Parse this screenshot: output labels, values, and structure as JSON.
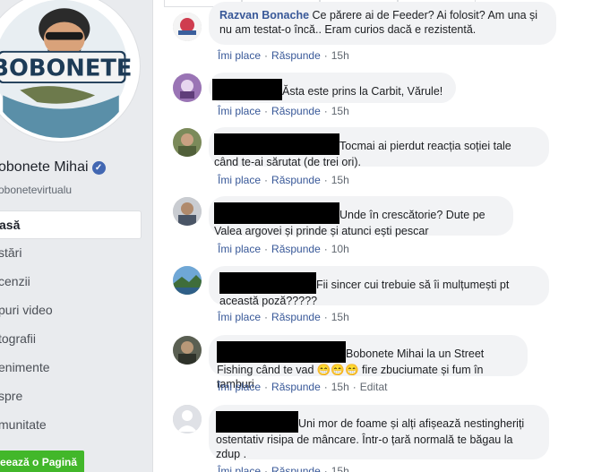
{
  "sidebar": {
    "logo_text": "BOBONETE",
    "page_name": "obonete Mihai",
    "handle": "obonetevirtualu",
    "nav_items": [
      {
        "label": "asă",
        "active": true
      },
      {
        "label": "stări",
        "active": false
      },
      {
        "label": "cenzii",
        "active": false
      },
      {
        "label": "puri video",
        "active": false
      },
      {
        "label": "tografii",
        "active": false
      },
      {
        "label": "enimente",
        "active": false
      },
      {
        "label": "spre",
        "active": false
      },
      {
        "label": "munitate",
        "active": false
      }
    ],
    "create_page_button": "eează o Pagină"
  },
  "actions": {
    "like": "Îmi place",
    "reply": "Răspunde",
    "edited": "Editat"
  },
  "comments": [
    {
      "author": "Razvan Bonache",
      "text": "Ce părere ai de Feeder? Ai folosit? Am una și nu am testat-o încă.. Eram curios dacă e rezistentă.",
      "time": "15h"
    },
    {
      "text": "Ăsta este prins la Carbit, Vărule!",
      "time": "15h"
    },
    {
      "text": "Tocmai ai pierdut reacția soției tale când te-ai sărutat (de trei ori).",
      "time": "15h"
    },
    {
      "text": "Unde în crescătorie? Dute pe Valea argovei și prinde și atunci ești pescar",
      "time": "10h"
    },
    {
      "text": "Fii sincer cui trebuie să îi mulțumești pt această poză?????",
      "time": "15h"
    },
    {
      "text": "Bobonete Mihai la un Street Fishing când te vad 😁😁😁 fire zbuciumate și fum în tamburi.",
      "time": "15h",
      "edited": true
    },
    {
      "text": "Uni mor de foame și alți afișează nestingheriți ostentativ risipa de mâncare. Într-o țară normală te băgau la zdup .",
      "time": "15h"
    }
  ]
}
